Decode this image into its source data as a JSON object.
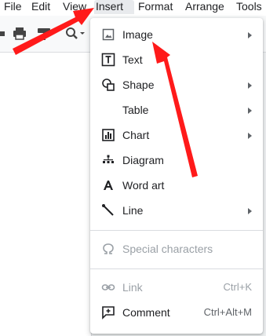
{
  "menubar": {
    "items": [
      "File",
      "Edit",
      "View",
      "Insert",
      "Format",
      "Arrange",
      "Tools"
    ],
    "active": "Insert"
  },
  "toolbar": {
    "icons": [
      "undo-icon",
      "print-icon",
      "paint-format-icon",
      "zoom-icon"
    ]
  },
  "insert_menu": {
    "items": [
      {
        "label": "Image",
        "icon": "image-icon",
        "submenu": true
      },
      {
        "label": "Text",
        "icon": "text-box-icon",
        "submenu": false
      },
      {
        "label": "Shape",
        "icon": "shape-icon",
        "submenu": true
      },
      {
        "label": "Table",
        "icon": "",
        "submenu": true
      },
      {
        "label": "Chart",
        "icon": "chart-icon",
        "submenu": true
      },
      {
        "label": "Diagram",
        "icon": "diagram-icon",
        "submenu": false
      },
      {
        "label": "Word art",
        "icon": "word-art-icon",
        "submenu": false
      },
      {
        "label": "Line",
        "icon": "line-icon",
        "submenu": true
      },
      {
        "label": "Special characters",
        "icon": "omega-icon",
        "disabled": true
      },
      {
        "label": "Link",
        "icon": "link-icon",
        "disabled": true,
        "shortcut": "Ctrl+K"
      },
      {
        "label": "Comment",
        "icon": "add-comment-icon",
        "shortcut": "Ctrl+Alt+M"
      }
    ]
  },
  "colors": {
    "arrow": "#ff1a1a",
    "active_menu": "#e8eaed",
    "disabled_text": "#9aa0a6"
  }
}
